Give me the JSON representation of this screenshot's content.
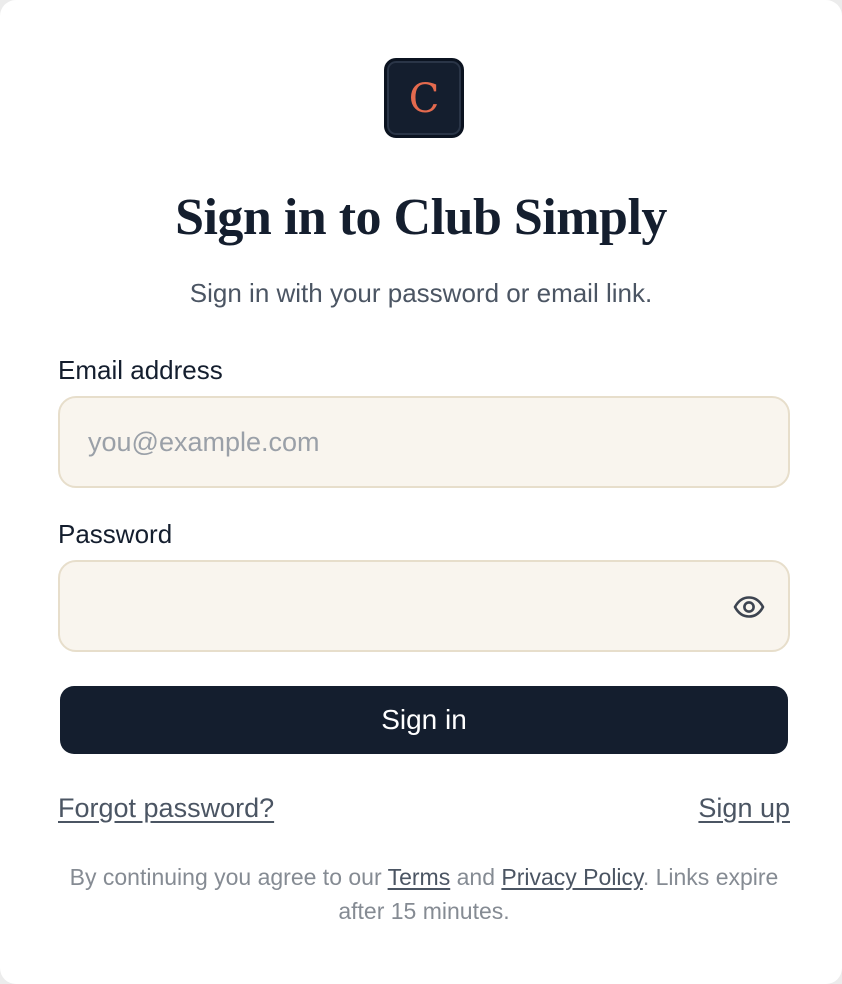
{
  "brand": {
    "logo_letter": "C",
    "accent_color": "#e46a4e",
    "dark_color": "#141e2e"
  },
  "header": {
    "title": "Sign in to Club Simply",
    "subtitle": "Sign in with your password or email link."
  },
  "form": {
    "email_label": "Email address",
    "email_placeholder": "you@example.com",
    "email_value": "",
    "password_label": "Password",
    "password_value": "",
    "password_toggle_icon": "eye-icon",
    "submit_label": "Sign in"
  },
  "links": {
    "forgot_password": "Forgot password?",
    "sign_up": "Sign up"
  },
  "legal": {
    "prefix": "By continuing you agree to our",
    "terms": "Terms",
    "and": "and",
    "privacy": "Privacy Policy",
    "suffix": ". Links expire after 15 minutes."
  }
}
